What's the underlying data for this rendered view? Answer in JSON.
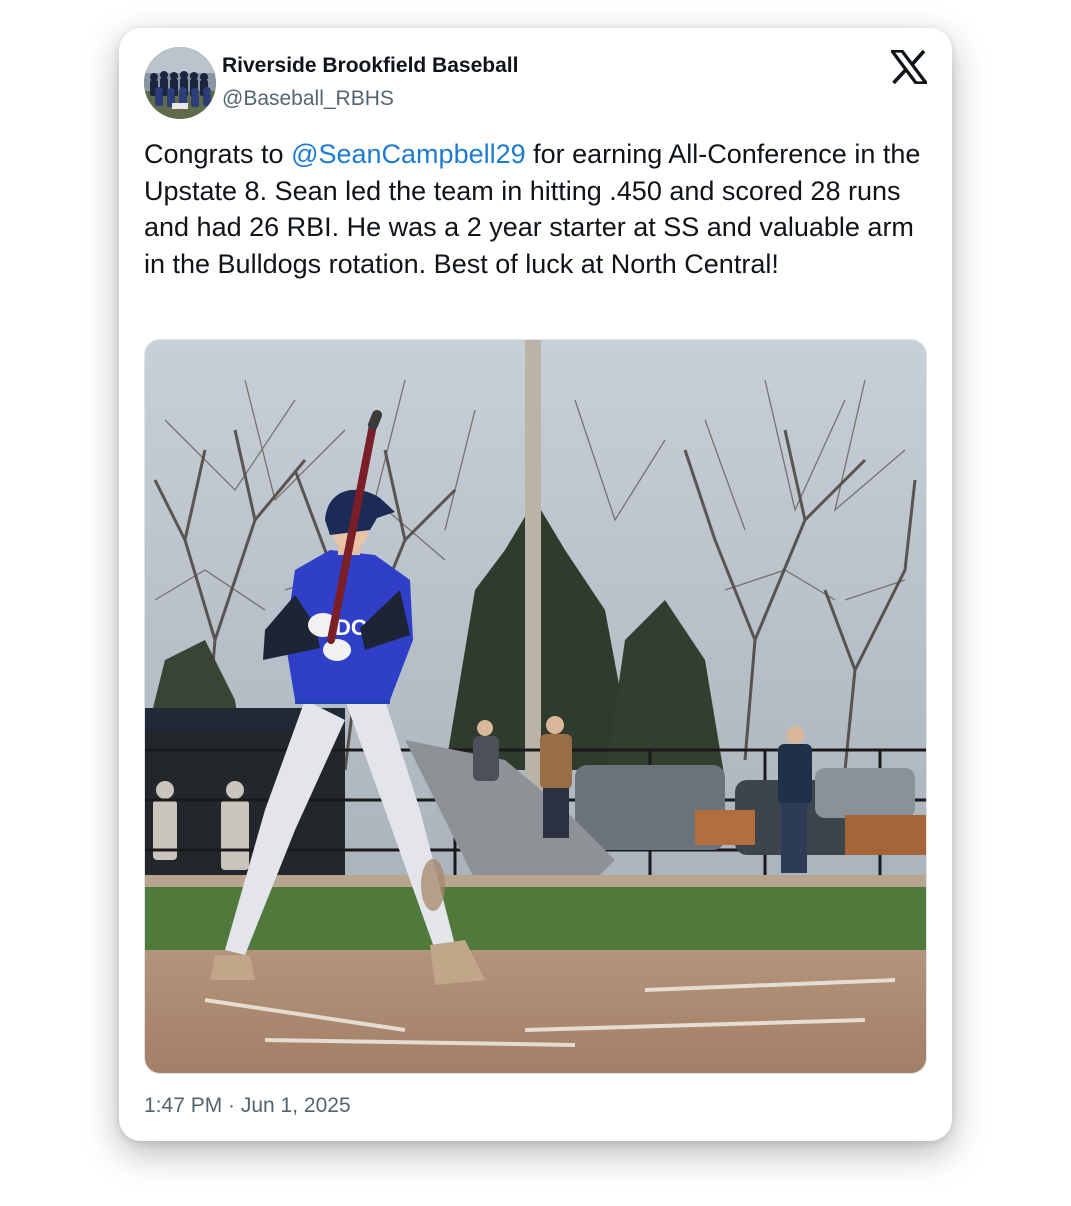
{
  "author": {
    "display_name": "Riverside Brookfield Baseball",
    "handle": "@Baseball_RBHS"
  },
  "logo": {
    "icon": "x-logo-icon"
  },
  "tweet": {
    "text_before": "Congrats to ",
    "mention": "@SeanCampbell29",
    "text_after": " for earning All-Conference in the Upstate 8. Sean led the team in hitting .450 and scored 28 runs and had 26 RBI. He was a 2 year starter at SS and valuable arm in the Bulldogs rotation. Best of luck at North Central!"
  },
  "media": {
    "jersey_text": "DOGS"
  },
  "footer": {
    "timestamp": "1:47 PM · Jun 1, 2025"
  },
  "colors": {
    "link": "#1d7bd1",
    "text": "#0f1419",
    "secondary": "#536471"
  }
}
